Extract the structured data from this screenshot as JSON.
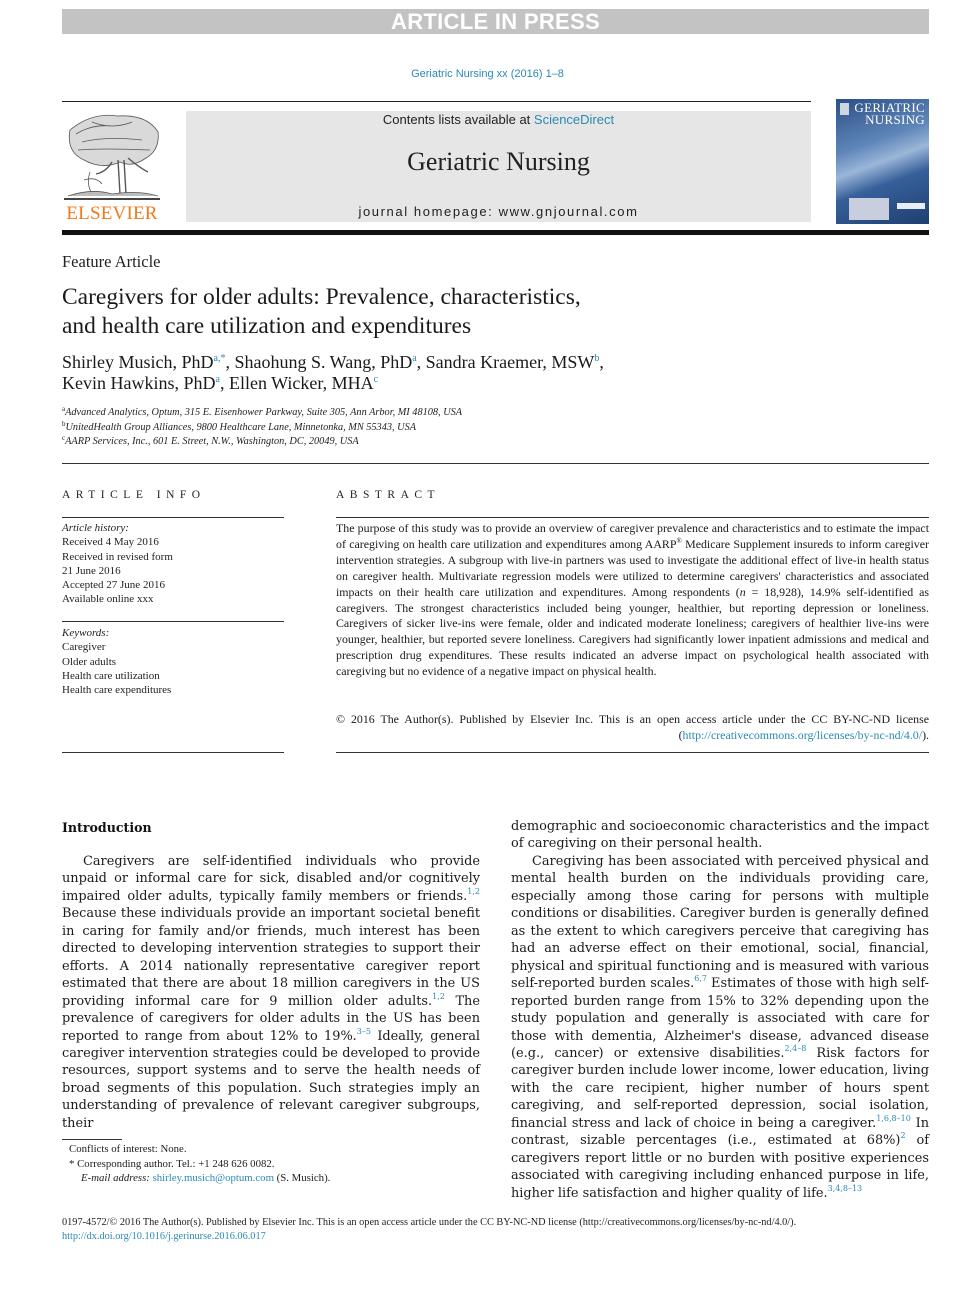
{
  "banner": "ARTICLE IN PRESS",
  "citation": "Geriatric Nursing xx (2016) 1–8",
  "header": {
    "publisher_logo_text": "ELSEVIER",
    "contents_prefix": "Contents lists available at ",
    "contents_link": "ScienceDirect",
    "journal_title": "Geriatric Nursing",
    "homepage": "journal homepage: www.gnjournal.com",
    "cover_title_line1": "Geriatric",
    "cover_title_line2": "Nursing"
  },
  "section_type": "Feature Article",
  "title_line1": "Caregivers for older adults: Prevalence, characteristics,",
  "title_line2": "and health care utilization and expenditures",
  "authors": [
    {
      "name": "Shirley Musich, PhD",
      "sup": "a,*",
      "sep": ", "
    },
    {
      "name": "Shaohung S. Wang, PhD",
      "sup": "a",
      "sep": ", "
    },
    {
      "name": "Sandra Kraemer, MSW",
      "sup": "b",
      "sep": ","
    },
    {
      "name": "Kevin Hawkins, PhD",
      "sup": "a",
      "sep": ", "
    },
    {
      "name": "Ellen Wicker, MHA",
      "sup": "c",
      "sep": ""
    }
  ],
  "affiliations": [
    {
      "key": "a",
      "text": "Advanced Analytics, Optum, 315 E. Eisenhower Parkway, Suite 305, Ann Arbor, MI 48108, USA"
    },
    {
      "key": "b",
      "text": "UnitedHealth Group Alliances, 9800 Healthcare Lane, Minnetonka, MN 55343, USA"
    },
    {
      "key": "c",
      "text": "AARP Services, Inc., 601 E. Street, N.W., Washington, DC, 20049, USA"
    }
  ],
  "article_info": {
    "heading": "ARTICLE INFO",
    "history_label": "Article history:",
    "history": [
      "Received 4 May 2016",
      "Received in revised form",
      "21 June 2016",
      "Accepted 27 June 2016",
      "Available online xxx"
    ],
    "keywords_label": "Keywords:",
    "keywords": [
      "Caregiver",
      "Older adults",
      "Health care utilization",
      "Health care expenditures"
    ]
  },
  "abstract": {
    "heading": "ABSTRACT",
    "part1": "The purpose of this study was to provide an overview of caregiver prevalence and characteristics and to estimate the impact of caregiving on health care utilization and expenditures among AARP",
    "registered": "®",
    "part2": " Medicare Supplement insureds to inform caregiver intervention strategies. A subgroup with live-in partners was used to investigate the additional effect of live-in health status on caregiver health. Multivariate regression models were utilized to determine caregivers' characteristics and associated impacts on their health care utilization and expenditures. Among respondents (",
    "n_symbol": "n",
    "part3": " = 18,928), 14.9% self-identified as caregivers. The strongest characteristics included being younger, healthier, but reporting depression or loneliness. Caregivers of sicker live-ins were female, older and indicated moderate loneliness; caregivers of healthier live-ins were younger, healthier, but reported severe loneliness. Caregivers had significantly lower inpatient admissions and medical and prescription drug expenditures. These results indicated an adverse impact on psychological health associated with caregiving but no evidence of a negative impact on physical health.",
    "copyright_prefix": "© 2016 The Author(s). Published by Elsevier Inc. This is an open access article under the CC BY-NC-ND license (",
    "license_url": "http://creativecommons.org/licenses/by-nc-nd/4.0/",
    "copyright_suffix": ")."
  },
  "intro": {
    "heading": "Introduction",
    "left": [
      {
        "t": "Caregivers are self-identified individuals who provide unpaid or informal care for sick, disabled and/or cognitively impaired older adults, typically family members or friends."
      },
      {
        "ref": "1,2"
      },
      {
        "t": " Because these individuals provide an important societal benefit in caring for family and/or friends, much interest has been directed to developing intervention strategies to support their efforts. A 2014 nationally representative caregiver report estimated that there are about 18 million caregivers in the US providing informal care for 9 million older adults."
      },
      {
        "ref": "1,2"
      },
      {
        "t": " The prevalence of caregivers for older adults in the US has been reported to range from about 12% to 19%."
      },
      {
        "ref": "3–5"
      },
      {
        "t": " Ideally, general caregiver intervention strategies could be developed to provide resources, support systems and to serve the health needs of broad segments of this population. Such strategies imply an understanding of prevalence of relevant caregiver subgroups, their"
      }
    ],
    "right_p1": "demographic and socioeconomic characteristics and the impact of caregiving on their personal health.",
    "right_p2": [
      {
        "t": "Caregiving has been associated with perceived physical and mental health burden on the individuals providing care, especially among those caring for persons with multiple conditions or disabilities. Caregiver burden is generally defined as the extent to which caregivers perceive that caregiving has had an adverse effect on their emotional, social, financial, physical and spiritual functioning and is measured with various self-reported burden scales."
      },
      {
        "ref": "6,7"
      },
      {
        "t": " Estimates of those with high self-reported burden range from 15% to 32% depending upon the study population and generally is associated with care for those with dementia, Alzheimer's disease, advanced disease (e.g., cancer) or extensive disabilities."
      },
      {
        "ref": "2,4–8"
      },
      {
        "t": " Risk factors for caregiver burden include lower income, lower education, living with the care recipient, higher number of hours spent caregiving, and self-reported depression, social isolation, financial stress and lack of choice in being a caregiver."
      },
      {
        "ref": "1,6,8–10"
      },
      {
        "t": " In contrast, sizable percentages (i.e., estimated at 68%)"
      },
      {
        "ref": "2"
      },
      {
        "t": " of caregivers report little or no burden with positive experiences associated with caregiving including enhanced purpose in life, higher life satisfaction and higher quality of life."
      },
      {
        "ref": "3,4,8–13"
      }
    ]
  },
  "footnotes": {
    "conflicts": "Conflicts of interest: None.",
    "corresponding": "* Corresponding author. Tel.: +1 248 626 0082.",
    "email_label": "E-mail address:",
    "email": "shirley.musich@optum.com",
    "email_suffix": " (S. Musich)."
  },
  "bottom": {
    "issn_line": "0197-4572/© 2016 The Author(s). Published by Elsevier Inc. This is an open access article under the CC BY-NC-ND license (http://creativecommons.org/licenses/by-nc-nd/4.0/).",
    "doi": "http://dx.doi.org/10.1016/j.gerinurse.2016.06.017"
  },
  "colors": {
    "link": "#2a8ab5",
    "elsevier_orange": "#f07a1a",
    "banner_gray": "#c3c3c3",
    "journal_box": "#e6e6e6"
  }
}
